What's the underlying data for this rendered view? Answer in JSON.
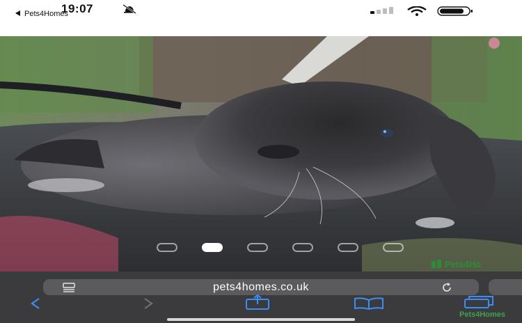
{
  "status_bar": {
    "time": "19:07",
    "back_app_label": "Pets4Homes",
    "icons": [
      "bell-slash-icon",
      "cellular-signal-icon",
      "wifi-icon",
      "battery-icon"
    ]
  },
  "gallery": {
    "image_alt": "grey rabbit photo",
    "slide_count": 6,
    "active_slide": 2,
    "watermark": "Pets4Ho"
  },
  "browser": {
    "url": "pets4homes.co.uk",
    "bottom_watermark": "Pets4Homes",
    "icons": [
      "reader-mode-icon",
      "reload-icon",
      "back-arrow-icon",
      "forward-arrow-icon",
      "share-icon",
      "bookmarks-icon",
      "tabs-icon"
    ]
  },
  "colors": {
    "toolbar_bg": "#3b3b3d",
    "url_bar_bg": "#5b5b5e",
    "accent_blue": "#3a8ef6",
    "watermark_green": "#2f8b3a"
  }
}
